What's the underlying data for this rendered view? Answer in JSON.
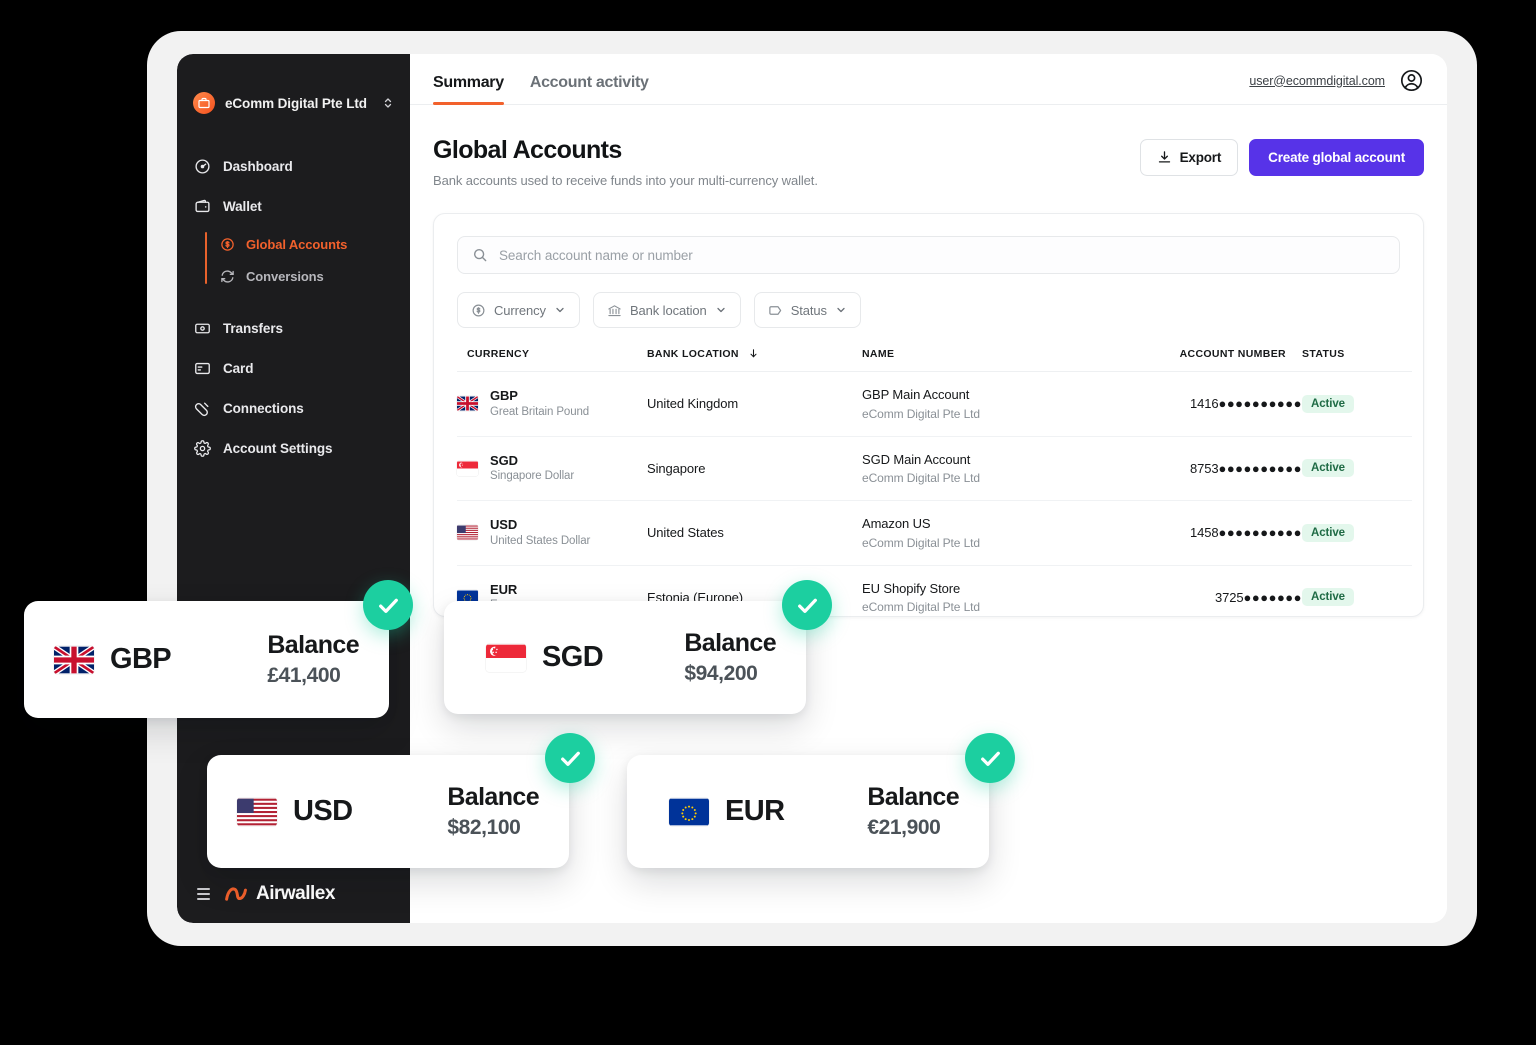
{
  "sidebar": {
    "org": {
      "name": "eComm Digital Pte Ltd",
      "logo_icon": "briefcase-icon",
      "switcher_icon": "chevron-up-down-icon"
    },
    "items": [
      {
        "label": "Dashboard",
        "icon": "dashboard-icon"
      },
      {
        "label": "Wallet",
        "icon": "wallet-icon"
      },
      {
        "label": "Transfers",
        "icon": "transfers-icon"
      },
      {
        "label": "Card",
        "icon": "card-icon"
      },
      {
        "label": "Connections",
        "icon": "connections-icon"
      },
      {
        "label": "Account Settings",
        "icon": "gear-icon"
      }
    ],
    "wallet_subitems": [
      {
        "label": "Global Accounts",
        "icon": "dollar-circle-icon",
        "active": true
      },
      {
        "label": "Conversions",
        "icon": "refresh-icon",
        "active": false
      }
    ],
    "brand": {
      "name": "Airwallex",
      "menu_icon": "hamburger-icon"
    },
    "active_color": "#f2612c"
  },
  "topbar": {
    "tabs": [
      {
        "label": "Summary",
        "active": true
      },
      {
        "label": "Account activity",
        "active": false
      }
    ],
    "user_email": "user@ecommdigital.com",
    "avatar_icon": "user-circle-icon"
  },
  "page": {
    "title": "Global Accounts",
    "subtitle": "Bank accounts used to receive funds into your multi-currency wallet.",
    "export_label": "Export",
    "export_icon": "download-icon",
    "create_label": "Create global account",
    "primary_color": "#5733e8"
  },
  "search": {
    "placeholder": "Search account name or number",
    "icon": "search-icon"
  },
  "filters": [
    {
      "label": "Currency",
      "icon": "dollar-circle-icon",
      "chevron": "chevron-down-icon"
    },
    {
      "label": "Bank location",
      "icon": "bank-icon",
      "chevron": "chevron-down-icon"
    },
    {
      "label": "Status",
      "icon": "tag-icon",
      "chevron": "chevron-down-icon"
    }
  ],
  "table": {
    "columns": [
      {
        "label": "CURRENCY"
      },
      {
        "label": "BANK LOCATION",
        "sort_icon": "arrow-down-icon"
      },
      {
        "label": "NAME"
      },
      {
        "label": "ACCOUNT NUMBER"
      },
      {
        "label": "STATUS"
      }
    ],
    "rows": [
      {
        "currency_code": "GBP",
        "currency_name": "Great Britain Pound",
        "flag": "gb",
        "bank_location": "United Kingdom",
        "account_name": "GBP Main Account",
        "account_org": "eComm Digital Pte Ltd",
        "account_number_prefix": "1416",
        "account_number_mask": "●●●●●●●●●●",
        "status": "Active"
      },
      {
        "currency_code": "SGD",
        "currency_name": "Singapore Dollar",
        "flag": "sg",
        "bank_location": "Singapore",
        "account_name": "SGD Main Account",
        "account_org": "eComm Digital Pte Ltd",
        "account_number_prefix": "8753",
        "account_number_mask": "●●●●●●●●●●",
        "status": "Active"
      },
      {
        "currency_code": "USD",
        "currency_name": "United States Dollar",
        "flag": "us",
        "bank_location": "United States",
        "account_name": "Amazon US",
        "account_org": "eComm Digital Pte Ltd",
        "account_number_prefix": "1458",
        "account_number_mask": "●●●●●●●●●●",
        "status": "Active"
      },
      {
        "currency_code": "EUR",
        "currency_name": "Euro",
        "flag": "eu",
        "bank_location": "Estonia (Europe)",
        "account_name": "EU Shopify Store",
        "account_org": "eComm Digital Pte Ltd",
        "account_number_prefix": "3725",
        "account_number_mask": "●●●●●●●",
        "status": "Active"
      }
    ]
  },
  "balance_cards": [
    {
      "code": "GBP",
      "flag": "gb",
      "label": "Balance",
      "amount": "£41,400",
      "check_icon": "check-circle-icon"
    },
    {
      "code": "SGD",
      "flag": "sg",
      "label": "Balance",
      "amount": "$94,200",
      "check_icon": "check-circle-icon"
    },
    {
      "code": "USD",
      "flag": "us",
      "label": "Balance",
      "amount": "$82,100",
      "check_icon": "check-circle-icon"
    },
    {
      "code": "EUR",
      "flag": "eu",
      "label": "Balance",
      "amount": "€21,900",
      "check_icon": "check-circle-icon"
    }
  ],
  "colors": {
    "accent_orange": "#f2612c",
    "primary_purple": "#5733e8",
    "success_green": "#1ccfa0",
    "badge_bg": "#e3f7ec",
    "sidebar_bg": "#1c1c1e"
  }
}
